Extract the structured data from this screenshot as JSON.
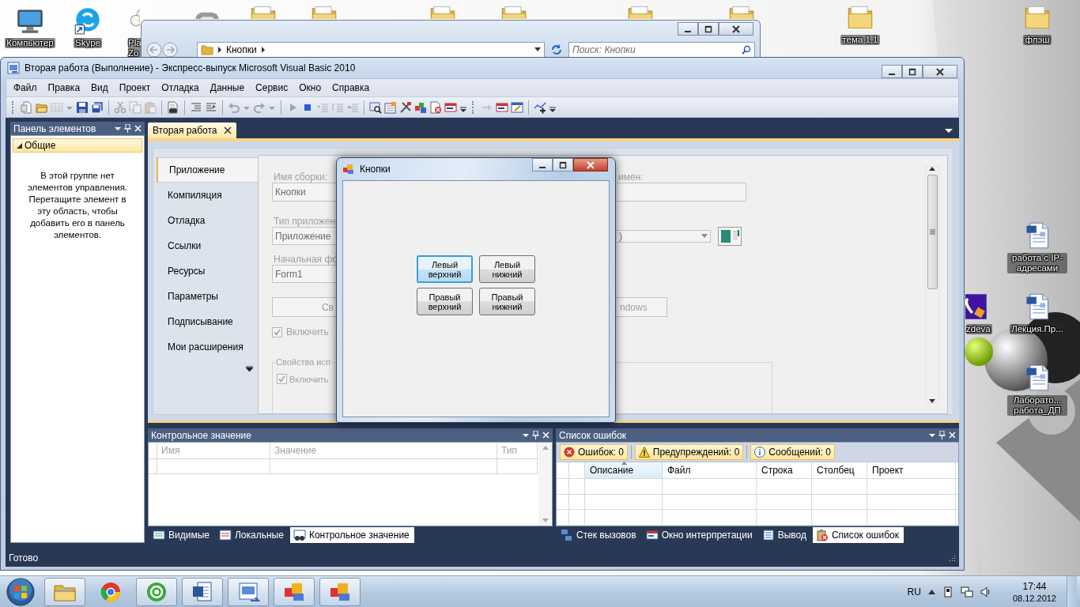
{
  "desktop": {
    "icons": [
      {
        "kind": "computer",
        "label": "Компьютер"
      },
      {
        "kind": "chat",
        "label": "Skype"
      },
      {
        "kind": "flower",
        "label": "Pla Zo"
      },
      {
        "kind": "gadget"
      },
      {
        "kind": "folder"
      },
      {
        "kind": "folder"
      },
      {
        "kind": "folder"
      },
      {
        "kind": "folder"
      },
      {
        "kind": "folder"
      },
      {
        "kind": "folder"
      },
      {
        "kind": "folder",
        "label": "тема 1.1"
      },
      {
        "kind": "folder",
        "label": "флэш"
      },
      {
        "kind": "document",
        "label": "работа с IP-адресами"
      },
      {
        "kind": "app",
        "label": "zdeva"
      },
      {
        "kind": "document",
        "label": "Лекция.Пр..."
      },
      {
        "kind": "document",
        "label": "Лаборато... работа_ДП"
      }
    ]
  },
  "explorer": {
    "breadcrumb": [
      "Кнопки"
    ],
    "search": {
      "placeholder": "Поиск: Кнопки"
    }
  },
  "ide": {
    "title": "Вторая работа (Выполнение) - Экспресс-выпуск Microsoft Visual Basic 2010",
    "menu": [
      "Файл",
      "Правка",
      "Вид",
      "Проект",
      "Отладка",
      "Данные",
      "Сервис",
      "Окно",
      "Справка"
    ],
    "toolbar": [
      [
        {
          "kind": "doc",
          "disabled": false
        },
        {
          "kind": "folder",
          "disabled": false
        },
        {
          "kind": "grid",
          "disabled": true
        },
        {
          "kind": "caret",
          "disabled": true
        },
        {
          "kind": "save",
          "disabled": false
        },
        {
          "kind": "saveall",
          "disabled": false
        }
      ],
      [
        {
          "kind": "cut",
          "disabled": true
        },
        {
          "kind": "copy",
          "disabled": true
        },
        {
          "kind": "paste",
          "disabled": true
        }
      ],
      [
        {
          "kind": "docfind",
          "disabled": false
        }
      ],
      [
        {
          "kind": "indent",
          "disabled": false
        },
        {
          "kind": "outdent",
          "disabled": false
        }
      ],
      [
        {
          "kind": "undo",
          "disabled": true
        },
        {
          "kind": "caret",
          "disabled": true
        },
        {
          "kind": "redo",
          "disabled": true
        },
        {
          "kind": "caret",
          "disabled": true
        }
      ],
      [
        {
          "kind": "play",
          "disabled": true
        },
        {
          "kind": "stop",
          "disabled": false
        },
        {
          "kind": "stepin",
          "disabled": true
        },
        {
          "kind": "stepover",
          "disabled": true
        },
        {
          "kind": "stepout",
          "disabled": true
        }
      ],
      [
        {
          "kind": "find",
          "disabled": false
        },
        {
          "kind": "props",
          "disabled": false
        },
        {
          "kind": "tools",
          "disabled": false
        },
        {
          "kind": "toolbox",
          "disabled": false
        },
        {
          "kind": "errwin",
          "disabled": false
        },
        {
          "kind": "window",
          "disabled": false
        },
        {
          "kind": "overflow",
          "disabled": false
        }
      ],
      [
        {
          "kind": "arrow",
          "disabled": true
        },
        {
          "kind": "window",
          "disabled": false
        },
        {
          "kind": "wincheck",
          "disabled": false
        }
      ],
      [
        {
          "kind": "graph",
          "disabled": false
        },
        {
          "kind": "overflow",
          "disabled": false
        }
      ]
    ],
    "toolbox": {
      "title": "Панель элементов",
      "group": {
        "label": "Общие",
        "expanded": true
      },
      "message": "В этой группе нет элементов управления. Перетащите элемент в эту область, чтобы добавить его в панель элементов."
    },
    "documents": [
      {
        "label": "Вторая работа",
        "selected": true
      }
    ],
    "project_designer": {
      "disabled": true,
      "tabs": [
        {
          "label": "Приложение",
          "selected": true
        },
        {
          "label": "Компиляция",
          "selected": false
        },
        {
          "label": "Отладка",
          "selected": false
        },
        {
          "label": "Ссылки",
          "selected": false
        },
        {
          "label": "Ресурсы",
          "selected": false
        },
        {
          "label": "Параметры",
          "selected": false
        },
        {
          "label": "Подписывание",
          "selected": false
        },
        {
          "label": "Мои расширения",
          "selected": false
        }
      ],
      "assembly_name_label": "Имя сборки:",
      "assembly_name": "Кнопки",
      "namespace_label": "имен:",
      "app_type_label": "Тип приложен",
      "app_type": "Приложение",
      "icon_value": ")",
      "startup_form_label": "Начальная фо",
      "startup_form": "Form1",
      "button_left": "Св",
      "button_right": "ndows",
      "checkbox": {
        "label": "Включить",
        "checked": true
      },
      "group": {
        "title": "Свойства исп",
        "checkbox": {
          "label": "Включить",
          "checked": true
        }
      }
    },
    "form": {
      "title": "Кнопки",
      "buttons": [
        {
          "label": "Левый верхний",
          "focused": true
        },
        {
          "label": "Левый нижний",
          "focused": false
        },
        {
          "label": "Правый верхний",
          "focused": false
        },
        {
          "label": "Правый нижний",
          "focused": false
        }
      ]
    },
    "watch": {
      "title": "Контрольное значение",
      "columns": [
        "Имя",
        "Значение",
        "Тип"
      ],
      "tabs": [
        {
          "kind": "autos",
          "label": "Видимые",
          "selected": false
        },
        {
          "kind": "locals",
          "label": "Локальные",
          "selected": false
        },
        {
          "kind": "watch",
          "label": "Контрольное значение",
          "selected": true
        }
      ]
    },
    "error_list": {
      "title": "Список ошибок",
      "filters": [
        {
          "kind": "error",
          "label": "Ошибок: 0",
          "on": true
        },
        {
          "kind": "warning",
          "label": "Предупреждений: 0",
          "on": true
        },
        {
          "kind": "info",
          "label": "Сообщений: 0",
          "on": true
        }
      ],
      "columns": [
        {
          "label": "Описание",
          "sorted": true
        },
        {
          "label": "Файл",
          "sorted": false
        },
        {
          "label": "Строка",
          "sorted": false
        },
        {
          "label": "Столбец",
          "sorted": false
        },
        {
          "label": "Проект",
          "sorted": false
        }
      ],
      "tabs": [
        {
          "kind": "stack",
          "label": "Стек вызовов",
          "selected": false
        },
        {
          "kind": "immediate",
          "label": "Окно интерпретации",
          "selected": false
        },
        {
          "kind": "output",
          "label": "Вывод",
          "selected": false
        },
        {
          "kind": "errors",
          "label": "Список ошибок",
          "selected": true
        }
      ]
    },
    "status_bar": "Готово"
  },
  "taskbar": {
    "apps": [
      {
        "kind": "explorer",
        "running": true
      },
      {
        "kind": "browser",
        "running": false
      },
      {
        "kind": "mail",
        "running": true
      },
      {
        "kind": "word",
        "running": true
      },
      {
        "kind": "vb",
        "running": true
      },
      {
        "kind": "app",
        "running": true
      },
      {
        "kind": "app",
        "running": true
      }
    ],
    "language": "RU",
    "time": "17:44",
    "date": "08.12.2012"
  }
}
